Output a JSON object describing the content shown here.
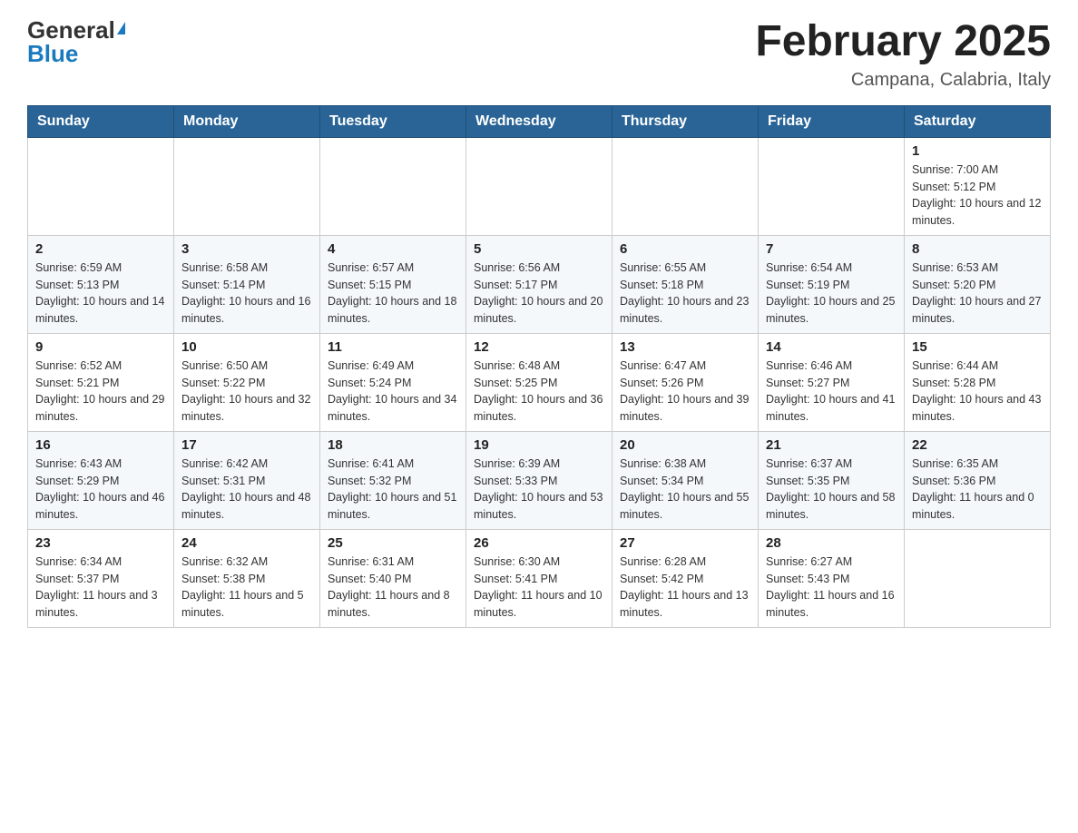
{
  "header": {
    "logo_general": "General",
    "logo_blue": "Blue",
    "month_title": "February 2025",
    "location": "Campana, Calabria, Italy"
  },
  "weekdays": [
    "Sunday",
    "Monday",
    "Tuesday",
    "Wednesday",
    "Thursday",
    "Friday",
    "Saturday"
  ],
  "weeks": [
    [
      {
        "day": "",
        "sunrise": "",
        "sunset": "",
        "daylight": ""
      },
      {
        "day": "",
        "sunrise": "",
        "sunset": "",
        "daylight": ""
      },
      {
        "day": "",
        "sunrise": "",
        "sunset": "",
        "daylight": ""
      },
      {
        "day": "",
        "sunrise": "",
        "sunset": "",
        "daylight": ""
      },
      {
        "day": "",
        "sunrise": "",
        "sunset": "",
        "daylight": ""
      },
      {
        "day": "",
        "sunrise": "",
        "sunset": "",
        "daylight": ""
      },
      {
        "day": "1",
        "sunrise": "Sunrise: 7:00 AM",
        "sunset": "Sunset: 5:12 PM",
        "daylight": "Daylight: 10 hours and 12 minutes."
      }
    ],
    [
      {
        "day": "2",
        "sunrise": "Sunrise: 6:59 AM",
        "sunset": "Sunset: 5:13 PM",
        "daylight": "Daylight: 10 hours and 14 minutes."
      },
      {
        "day": "3",
        "sunrise": "Sunrise: 6:58 AM",
        "sunset": "Sunset: 5:14 PM",
        "daylight": "Daylight: 10 hours and 16 minutes."
      },
      {
        "day": "4",
        "sunrise": "Sunrise: 6:57 AM",
        "sunset": "Sunset: 5:15 PM",
        "daylight": "Daylight: 10 hours and 18 minutes."
      },
      {
        "day": "5",
        "sunrise": "Sunrise: 6:56 AM",
        "sunset": "Sunset: 5:17 PM",
        "daylight": "Daylight: 10 hours and 20 minutes."
      },
      {
        "day": "6",
        "sunrise": "Sunrise: 6:55 AM",
        "sunset": "Sunset: 5:18 PM",
        "daylight": "Daylight: 10 hours and 23 minutes."
      },
      {
        "day": "7",
        "sunrise": "Sunrise: 6:54 AM",
        "sunset": "Sunset: 5:19 PM",
        "daylight": "Daylight: 10 hours and 25 minutes."
      },
      {
        "day": "8",
        "sunrise": "Sunrise: 6:53 AM",
        "sunset": "Sunset: 5:20 PM",
        "daylight": "Daylight: 10 hours and 27 minutes."
      }
    ],
    [
      {
        "day": "9",
        "sunrise": "Sunrise: 6:52 AM",
        "sunset": "Sunset: 5:21 PM",
        "daylight": "Daylight: 10 hours and 29 minutes."
      },
      {
        "day": "10",
        "sunrise": "Sunrise: 6:50 AM",
        "sunset": "Sunset: 5:22 PM",
        "daylight": "Daylight: 10 hours and 32 minutes."
      },
      {
        "day": "11",
        "sunrise": "Sunrise: 6:49 AM",
        "sunset": "Sunset: 5:24 PM",
        "daylight": "Daylight: 10 hours and 34 minutes."
      },
      {
        "day": "12",
        "sunrise": "Sunrise: 6:48 AM",
        "sunset": "Sunset: 5:25 PM",
        "daylight": "Daylight: 10 hours and 36 minutes."
      },
      {
        "day": "13",
        "sunrise": "Sunrise: 6:47 AM",
        "sunset": "Sunset: 5:26 PM",
        "daylight": "Daylight: 10 hours and 39 minutes."
      },
      {
        "day": "14",
        "sunrise": "Sunrise: 6:46 AM",
        "sunset": "Sunset: 5:27 PM",
        "daylight": "Daylight: 10 hours and 41 minutes."
      },
      {
        "day": "15",
        "sunrise": "Sunrise: 6:44 AM",
        "sunset": "Sunset: 5:28 PM",
        "daylight": "Daylight: 10 hours and 43 minutes."
      }
    ],
    [
      {
        "day": "16",
        "sunrise": "Sunrise: 6:43 AM",
        "sunset": "Sunset: 5:29 PM",
        "daylight": "Daylight: 10 hours and 46 minutes."
      },
      {
        "day": "17",
        "sunrise": "Sunrise: 6:42 AM",
        "sunset": "Sunset: 5:31 PM",
        "daylight": "Daylight: 10 hours and 48 minutes."
      },
      {
        "day": "18",
        "sunrise": "Sunrise: 6:41 AM",
        "sunset": "Sunset: 5:32 PM",
        "daylight": "Daylight: 10 hours and 51 minutes."
      },
      {
        "day": "19",
        "sunrise": "Sunrise: 6:39 AM",
        "sunset": "Sunset: 5:33 PM",
        "daylight": "Daylight: 10 hours and 53 minutes."
      },
      {
        "day": "20",
        "sunrise": "Sunrise: 6:38 AM",
        "sunset": "Sunset: 5:34 PM",
        "daylight": "Daylight: 10 hours and 55 minutes."
      },
      {
        "day": "21",
        "sunrise": "Sunrise: 6:37 AM",
        "sunset": "Sunset: 5:35 PM",
        "daylight": "Daylight: 10 hours and 58 minutes."
      },
      {
        "day": "22",
        "sunrise": "Sunrise: 6:35 AM",
        "sunset": "Sunset: 5:36 PM",
        "daylight": "Daylight: 11 hours and 0 minutes."
      }
    ],
    [
      {
        "day": "23",
        "sunrise": "Sunrise: 6:34 AM",
        "sunset": "Sunset: 5:37 PM",
        "daylight": "Daylight: 11 hours and 3 minutes."
      },
      {
        "day": "24",
        "sunrise": "Sunrise: 6:32 AM",
        "sunset": "Sunset: 5:38 PM",
        "daylight": "Daylight: 11 hours and 5 minutes."
      },
      {
        "day": "25",
        "sunrise": "Sunrise: 6:31 AM",
        "sunset": "Sunset: 5:40 PM",
        "daylight": "Daylight: 11 hours and 8 minutes."
      },
      {
        "day": "26",
        "sunrise": "Sunrise: 6:30 AM",
        "sunset": "Sunset: 5:41 PM",
        "daylight": "Daylight: 11 hours and 10 minutes."
      },
      {
        "day": "27",
        "sunrise": "Sunrise: 6:28 AM",
        "sunset": "Sunset: 5:42 PM",
        "daylight": "Daylight: 11 hours and 13 minutes."
      },
      {
        "day": "28",
        "sunrise": "Sunrise: 6:27 AM",
        "sunset": "Sunset: 5:43 PM",
        "daylight": "Daylight: 11 hours and 16 minutes."
      },
      {
        "day": "",
        "sunrise": "",
        "sunset": "",
        "daylight": ""
      }
    ]
  ]
}
